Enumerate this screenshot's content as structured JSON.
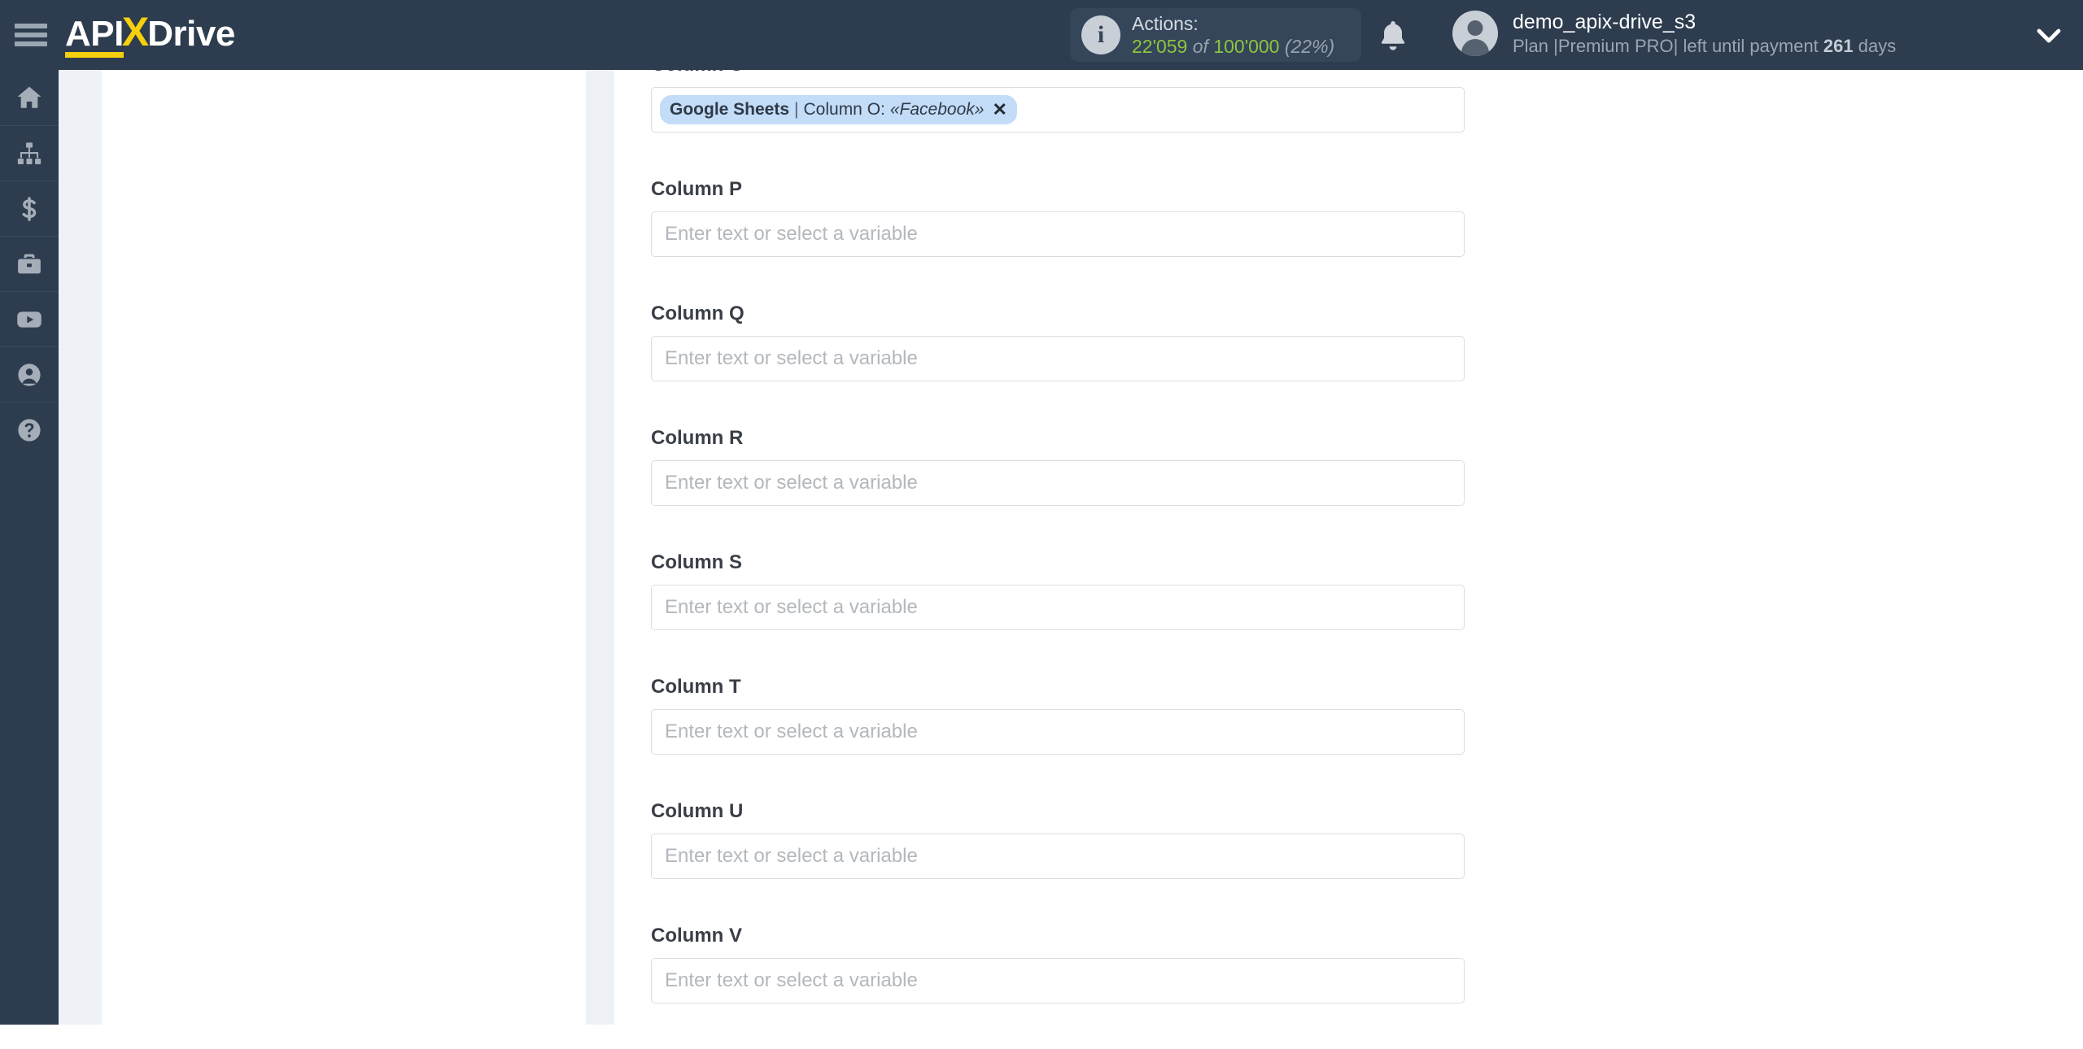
{
  "header": {
    "menu_icon": "hamburger-menu-icon",
    "logo": {
      "part1": "API",
      "part2": "X",
      "part3": "Drive"
    },
    "actions": {
      "info_icon": "info-icon",
      "title": "Actions:",
      "used": "22'059",
      "of": "of",
      "total": "100'000",
      "percent": "(22%)"
    },
    "notifications_icon": "bell-icon",
    "user": {
      "avatar_icon": "user-avatar-icon",
      "name": "demo_apix-drive_s3",
      "plan_prefix": "Plan |Premium PRO| left until payment ",
      "plan_days": "261",
      "plan_suffix": " days",
      "chevron_icon": "chevron-down-icon"
    }
  },
  "sidebar": {
    "items": [
      {
        "icon": "home-icon",
        "name": "sidebar-item-home"
      },
      {
        "icon": "sitemap-icon",
        "name": "sidebar-item-connections"
      },
      {
        "icon": "dollar-icon",
        "name": "sidebar-item-billing"
      },
      {
        "icon": "briefcase-icon",
        "name": "sidebar-item-business"
      },
      {
        "icon": "youtube-icon",
        "name": "sidebar-item-videos"
      },
      {
        "icon": "user-icon",
        "name": "sidebar-item-profile"
      },
      {
        "icon": "help-icon",
        "name": "sidebar-item-help"
      }
    ]
  },
  "form": {
    "placeholder": "Enter text or select a variable",
    "fields": [
      {
        "label": "Column O",
        "value": {
          "source": "Google Sheets",
          "separator": "|",
          "column": "Column O:",
          "variable": "«Facebook»",
          "remove": "✕"
        }
      },
      {
        "label": "Column P",
        "value": null
      },
      {
        "label": "Column Q",
        "value": null
      },
      {
        "label": "Column R",
        "value": null
      },
      {
        "label": "Column S",
        "value": null
      },
      {
        "label": "Column T",
        "value": null
      },
      {
        "label": "Column U",
        "value": null
      },
      {
        "label": "Column V",
        "value": null
      }
    ]
  },
  "colors": {
    "header_bg": "#2d3c4e",
    "accent_yellow": "#f6d00c",
    "chip_bg": "#c3dcf7",
    "quota_green": "#8dc63f",
    "page_bg": "#eef2f7"
  }
}
